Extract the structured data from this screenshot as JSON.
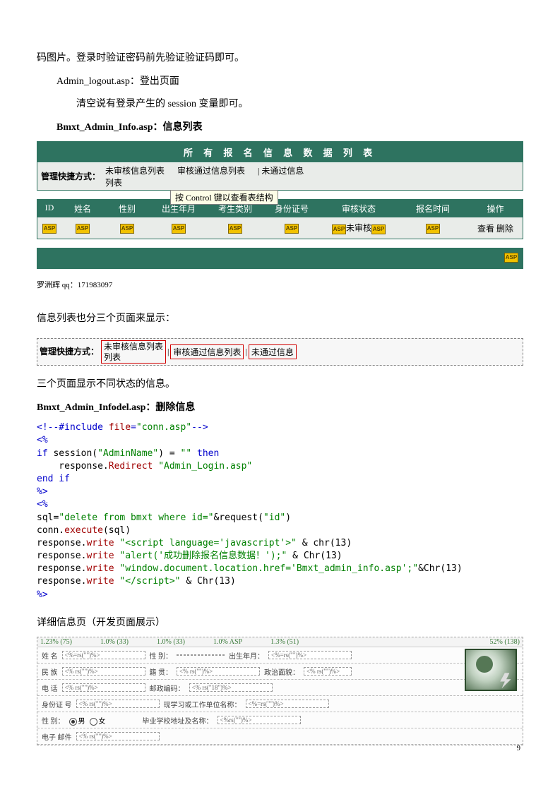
{
  "para1": "码图片。登录时验证密码前先验证验证码即可。",
  "para2_prefix": "Admin_logout.asp：",
  "para2_rest": "登出页面",
  "para3": "清空说有登录产生的 session 变量即可。",
  "para4_prefix": "Bmxt_Admin_Info.asp：",
  "para4_rest": "信息列表",
  "table1": {
    "title": "所 有 报 名 信 息 数 据 列 表",
    "shortcut_label": "管理快捷方式：",
    "links": [
      "未审核信息列表",
      "审核通过信息列表",
      "| 未通过信息"
    ],
    "link_wrap": "列表"
  },
  "control_hint": "按 Control 键以查看表结构",
  "columns": [
    "ID",
    "姓名",
    "性别",
    "出生年月",
    "考生类别",
    "身份证号",
    "审核状态",
    "报名时间",
    "操作"
  ],
  "status_text": "未审核",
  "op_view": "查看",
  "op_del": "删除",
  "asp": "ASP",
  "footer": "罗洲辉 qq：171983097",
  "section2": "信息列表也分三个页面来显示：",
  "shortcut2": {
    "label": "管理快捷方式：",
    "link1a": "未审核信息列表",
    "link1b": "列表",
    "link2": "审核通过信息列表",
    "link3": "未通过信息"
  },
  "section3": "三个页面显示不同状态的信息。",
  "section4_prefix": "Bmxt_Admin_Infodel.asp：",
  "section4_rest": "删除信息",
  "code": {
    "l1a": "<!--#include ",
    "l1b": "file",
    "l1c": "=",
    "l1d": "\"conn.asp\"",
    "l1e": "-->",
    "l2": "<%",
    "l3a": "if",
    "l3b": " session",
    "l3c": "(",
    "l3d": "\"AdminName\"",
    "l3e": ") = ",
    "l3f": "\"\"",
    "l3g": " then",
    "l4a": "    response.",
    "l4b": "Redirect",
    "l4c": " \"Admin_Login.asp\"",
    "l5": "end if",
    "l6": "%>",
    "l7": "<%",
    "l8a": "sql=",
    "l8b": "\"delete from bmxt where id=\"",
    "l8c": "&request(",
    "l8d": "\"id\"",
    "l8e": ")",
    "l9a": "conn.",
    "l9b": "execute",
    "l9c": "(sql)",
    "l10a": "response.",
    "l10b": "write",
    "l10c": " \"<script language='javascript'>\"",
    "l10d": " & chr(13)",
    "l11a": "response.",
    "l11b": "write",
    "l11c": " \"alert('成功删除报名信息数据！');\"",
    "l11d": " & Chr(13)",
    "l12a": "response.",
    "l12b": "write",
    "l12c": " \"window.document.location.href='Bmxt_admin_info.asp';\"",
    "l12d": "&Chr(13)",
    "l13a": "response.",
    "l13b": "write",
    "l13c": " \"</script>\"",
    "l13d": " & Chr(13)",
    "l14": "%>"
  },
  "section5": "详细信息页（开发页面展示）",
  "ruler": {
    "a": "1.23% (75)",
    "b": "1.0% (33)",
    "c": "1.0% (33)",
    "d": "1.0% ASP",
    "e": "1.3% (51)",
    "right": "52% (138)"
  },
  "form": {
    "r1_l1": "姓 名",
    "r1_v1": "<%=rs(\"\")%>",
    "r1_l2": "性 别：",
    "r1_v2": "",
    "r1_l3": "出生年月：",
    "r1_v3": "<%=rs(\"\")%>",
    "r2_l1": "民 族",
    "r2_v1": "<% rs(\"\")%>",
    "r2_l2": "籍 贯：",
    "r2_v2": "<% rs(\"\")%>",
    "r2_l3": "政治面貌：",
    "r2_v3": "<% rs(\"\")%>",
    "r3_l1": "电 话",
    "r3_v1": "<% rs(\"\")%>",
    "r3_l2": "邮政编码：",
    "r3_v2": "<% rs(\"18\")%>",
    "r4_l1": "身份证 号",
    "r4_v1": "<% rs(\"\")%>",
    "r4_l2": "现学习或工作单位名称：",
    "r4_v2": "<%=rs(\"\")%>",
    "r5_l1": "性 别：",
    "r5_r1": "男",
    "r5_r2": "女",
    "r5_l2": "毕业学校地址及名称：",
    "r5_v2": "<%rs(\"\")%>",
    "r6_l1": "电子 邮件",
    "r6_v1": "<% rs(\"\")%>"
  },
  "page_num": "9"
}
